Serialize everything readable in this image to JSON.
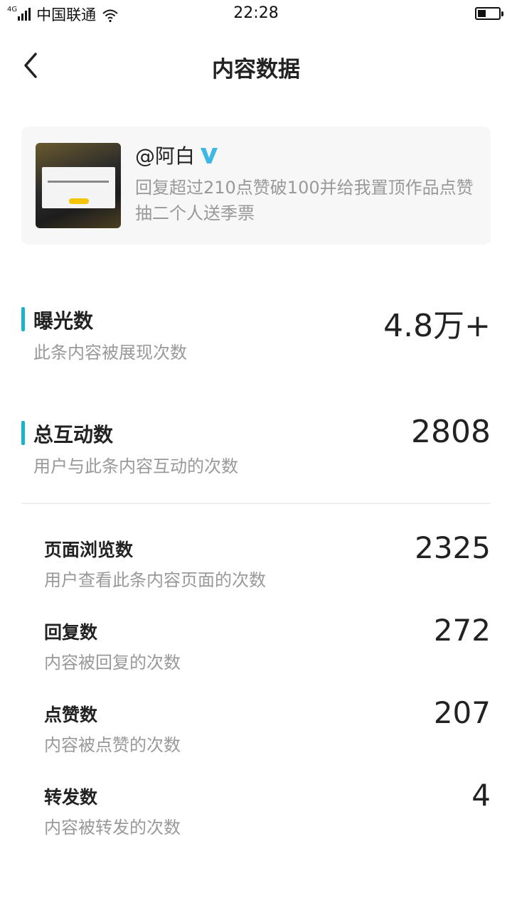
{
  "status_bar": {
    "network": "4G",
    "carrier": "中国联通",
    "time": "22:28"
  },
  "nav": {
    "title": "内容数据"
  },
  "post": {
    "username": "@阿白",
    "text": "回复超过210点赞破100并给我置顶作品点赞抽二个人送季票",
    "accent_color": "#3fb8e6"
  },
  "metrics": {
    "exposure": {
      "title": "曝光数",
      "desc": "此条内容被展现次数",
      "value": "4.8万+"
    },
    "interactions": {
      "title": "总互动数",
      "desc": "用户与此条内容互动的次数",
      "value": "2808"
    }
  },
  "sub_metrics": [
    {
      "title": "页面浏览数",
      "desc": "用户查看此条内容页面的次数",
      "value": "2325"
    },
    {
      "title": "回复数",
      "desc": "内容被回复的次数",
      "value": "272"
    },
    {
      "title": "点赞数",
      "desc": "内容被点赞的次数",
      "value": "207"
    },
    {
      "title": "转发数",
      "desc": "内容被转发的次数",
      "value": "4"
    }
  ],
  "colors": {
    "accent": "#19b4c8",
    "text_primary": "#222222",
    "text_secondary": "#999999"
  },
  "icons": {
    "back": "chevron-left-icon",
    "verified": "verified-v-icon",
    "wifi": "wifi-icon",
    "battery": "battery-icon",
    "signal": "signal-icon"
  }
}
